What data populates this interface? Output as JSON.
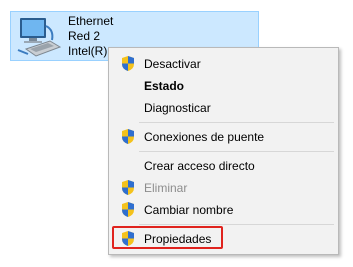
{
  "adapter": {
    "name": "Ethernet",
    "network": "Red 2",
    "device": "Intel(R)",
    "icon": "network-adapter-icon"
  },
  "context_menu": {
    "items": [
      {
        "label": "Desactivar",
        "shield": true,
        "bold": false,
        "disabled": false
      },
      {
        "label": "Estado",
        "shield": false,
        "bold": true,
        "disabled": false
      },
      {
        "label": "Diagnosticar",
        "shield": false,
        "bold": false,
        "disabled": false
      },
      {
        "label": "Conexiones de puente",
        "shield": true,
        "bold": false,
        "disabled": false
      },
      {
        "label": "Crear acceso directo",
        "shield": false,
        "bold": false,
        "disabled": false
      },
      {
        "label": "Eliminar",
        "shield": true,
        "bold": false,
        "disabled": true
      },
      {
        "label": "Cambiar nombre",
        "shield": true,
        "bold": false,
        "disabled": false
      },
      {
        "label": "Propiedades",
        "shield": true,
        "bold": false,
        "disabled": false,
        "highlighted": true
      }
    ],
    "shield_icon": "uac-shield-icon",
    "highlight_color": "#e0231e"
  }
}
